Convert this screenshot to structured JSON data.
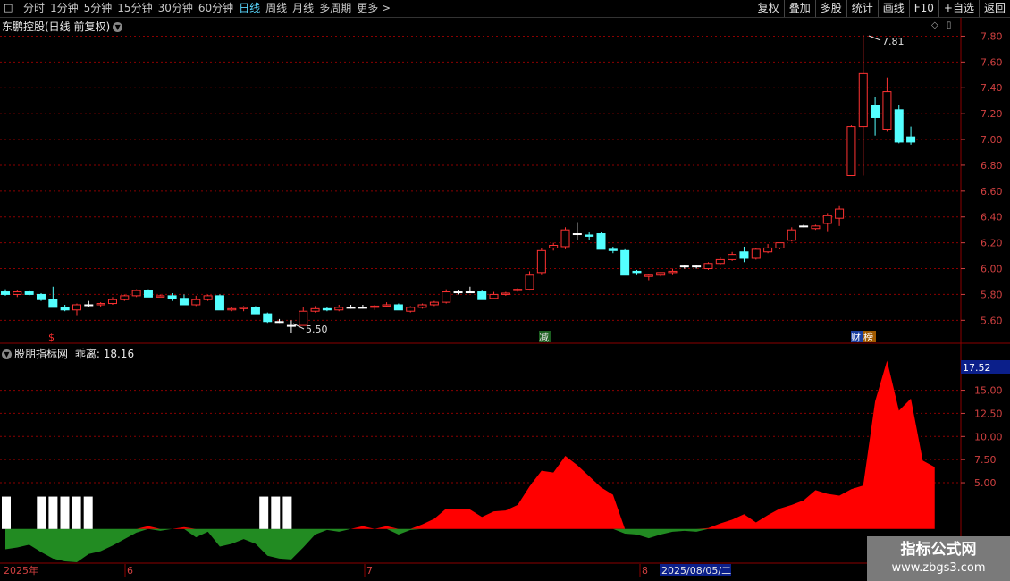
{
  "toolbar": {
    "periods": [
      "分时",
      "1分钟",
      "5分钟",
      "15分钟",
      "30分钟",
      "60分钟",
      "日线",
      "周线",
      "月线",
      "多周期",
      "更多 >"
    ],
    "active_period": "日线",
    "right_buttons": [
      "复权",
      "叠加",
      "多股",
      "统计",
      "画线",
      "F10",
      "+自选",
      "返回"
    ]
  },
  "main_header": {
    "title": "东鹏控股(日线 前复权)"
  },
  "sub_header": {
    "name": "股朋指标网",
    "label": "乖离:",
    "value": "18.16"
  },
  "main_axis": {
    "ticks": [
      "7.80",
      "7.60",
      "7.40",
      "7.20",
      "7.00",
      "6.80",
      "6.60",
      "6.40",
      "6.20",
      "6.00",
      "5.80",
      "5.60"
    ],
    "min": 5.45,
    "max": 7.9
  },
  "sub_axis": {
    "ticks": [
      "15.00",
      "12.50",
      "10.00",
      "7.50",
      "5.00"
    ],
    "current": "17.52",
    "min": -3.5,
    "max": 19.5
  },
  "annotations": {
    "high": "7.81",
    "low": "5.50"
  },
  "markers": {
    "m1": "$",
    "m2": "减",
    "m3": "财",
    "m4": "榜"
  },
  "dates": {
    "d1": "2025年",
    "d2": "6",
    "d3": "7",
    "d4": "8",
    "d5": "2025/08/05/二"
  },
  "watermark": {
    "line1": "指标公式网",
    "line2": "www.zbgs3.com"
  },
  "colors": {
    "up": "#ff3232",
    "down": "#54ffff",
    "flat": "#ffffff",
    "bias_pos": "#ff0000",
    "bias_neg": "#228b22",
    "grid": "#8b0000"
  },
  "chart_data": {
    "type": "candlestick",
    "candles": [
      [
        5.82,
        5.84,
        5.79,
        5.8
      ],
      [
        5.8,
        5.83,
        5.78,
        5.82
      ],
      [
        5.82,
        5.83,
        5.79,
        5.8
      ],
      [
        5.8,
        5.81,
        5.75,
        5.76
      ],
      [
        5.76,
        5.86,
        5.7,
        5.7
      ],
      [
        5.7,
        5.72,
        5.67,
        5.68
      ],
      [
        5.68,
        5.73,
        5.64,
        5.72
      ],
      [
        5.72,
        5.75,
        5.7,
        5.72
      ],
      [
        5.72,
        5.74,
        5.7,
        5.73
      ],
      [
        5.73,
        5.78,
        5.72,
        5.76
      ],
      [
        5.76,
        5.8,
        5.75,
        5.79
      ],
      [
        5.79,
        5.84,
        5.78,
        5.83
      ],
      [
        5.83,
        5.84,
        5.78,
        5.78
      ],
      [
        5.78,
        5.8,
        5.78,
        5.79
      ],
      [
        5.79,
        5.81,
        5.75,
        5.77
      ],
      [
        5.77,
        5.8,
        5.72,
        5.72
      ],
      [
        5.72,
        5.79,
        5.71,
        5.76
      ],
      [
        5.76,
        5.8,
        5.75,
        5.79
      ],
      [
        5.79,
        5.8,
        5.68,
        5.68
      ],
      [
        5.68,
        5.7,
        5.67,
        5.69
      ],
      [
        5.69,
        5.71,
        5.67,
        5.7
      ],
      [
        5.7,
        5.71,
        5.65,
        5.65
      ],
      [
        5.65,
        5.66,
        5.58,
        5.59
      ],
      [
        5.59,
        5.61,
        5.58,
        5.59
      ],
      [
        5.56,
        5.6,
        5.5,
        5.56
      ],
      [
        5.56,
        5.7,
        5.56,
        5.67
      ],
      [
        5.67,
        5.71,
        5.66,
        5.69
      ],
      [
        5.69,
        5.7,
        5.67,
        5.68
      ],
      [
        5.68,
        5.72,
        5.67,
        5.7
      ],
      [
        5.7,
        5.72,
        5.69,
        5.7
      ],
      [
        5.7,
        5.72,
        5.69,
        5.7
      ],
      [
        5.7,
        5.72,
        5.68,
        5.71
      ],
      [
        5.71,
        5.74,
        5.7,
        5.72
      ],
      [
        5.72,
        5.73,
        5.68,
        5.68
      ],
      [
        5.67,
        5.71,
        5.66,
        5.7
      ],
      [
        5.7,
        5.73,
        5.69,
        5.72
      ],
      [
        5.72,
        5.75,
        5.71,
        5.74
      ],
      [
        5.74,
        5.84,
        5.73,
        5.82
      ],
      [
        5.82,
        5.83,
        5.8,
        5.82
      ],
      [
        5.82,
        5.86,
        5.81,
        5.82
      ],
      [
        5.82,
        5.83,
        5.76,
        5.76
      ],
      [
        5.77,
        5.82,
        5.77,
        5.8
      ],
      [
        5.8,
        5.82,
        5.79,
        5.81
      ],
      [
        5.83,
        5.85,
        5.82,
        5.84
      ],
      [
        5.84,
        5.98,
        5.83,
        5.95
      ],
      [
        5.97,
        6.16,
        5.95,
        6.14
      ],
      [
        6.16,
        6.2,
        6.14,
        6.18
      ],
      [
        6.17,
        6.32,
        6.15,
        6.3
      ],
      [
        6.27,
        6.36,
        6.22,
        6.27
      ],
      [
        6.26,
        6.28,
        6.22,
        6.25
      ],
      [
        6.27,
        6.28,
        6.15,
        6.15
      ],
      [
        6.15,
        6.17,
        6.12,
        6.14
      ],
      [
        6.14,
        6.15,
        5.95,
        5.95
      ],
      [
        5.98,
        5.99,
        5.95,
        5.97
      ],
      [
        5.94,
        5.96,
        5.91,
        5.95
      ],
      [
        5.95,
        5.97,
        5.94,
        5.97
      ],
      [
        5.97,
        6.0,
        5.95,
        5.98
      ],
      [
        6.02,
        6.03,
        6.0,
        6.02
      ],
      [
        6.02,
        6.03,
        6.0,
        6.02
      ],
      [
        6.0,
        6.05,
        5.99,
        6.04
      ],
      [
        6.04,
        6.09,
        6.03,
        6.07
      ],
      [
        6.07,
        6.13,
        6.06,
        6.11
      ],
      [
        6.13,
        6.17,
        6.05,
        6.08
      ],
      [
        6.08,
        6.16,
        6.07,
        6.15
      ],
      [
        6.13,
        6.19,
        6.12,
        6.16
      ],
      [
        6.16,
        6.2,
        6.15,
        6.2
      ],
      [
        6.22,
        6.32,
        6.21,
        6.3
      ],
      [
        6.33,
        6.34,
        6.32,
        6.33
      ],
      [
        6.31,
        6.34,
        6.3,
        6.33
      ],
      [
        6.35,
        6.43,
        6.29,
        6.41
      ],
      [
        6.39,
        6.49,
        6.33,
        6.46
      ],
      [
        6.72,
        7.11,
        6.72,
        7.1
      ],
      [
        7.1,
        7.81,
        6.72,
        7.51
      ],
      [
        7.26,
        7.33,
        7.03,
        7.17
      ],
      [
        7.08,
        7.48,
        7.06,
        7.37
      ],
      [
        7.23,
        7.27,
        6.97,
        6.98
      ],
      [
        7.02,
        7.1,
        6.96,
        6.98
      ]
    ],
    "bias": [
      -2.2,
      -2.0,
      -1.7,
      -2.5,
      -3.2,
      -3.5,
      -3.6,
      -2.7,
      -2.4,
      -1.8,
      -1.1,
      -0.4,
      0.3,
      -0.2,
      0.0,
      0.2,
      -0.9,
      -0.3,
      -1.9,
      -1.6,
      -1.1,
      -1.6,
      -2.9,
      -3.2,
      -3.3,
      -2.0,
      -0.6,
      -0.1,
      -0.3,
      0.0,
      0.3,
      0.0,
      0.3,
      -0.6,
      -0.1,
      0.5,
      1.1,
      2.2,
      2.1,
      2.1,
      1.3,
      1.9,
      2.0,
      2.6,
      4.6,
      6.3,
      6.1,
      7.9,
      6.9,
      5.7,
      4.5,
      3.7,
      -0.5,
      -0.6,
      -1.0,
      -0.6,
      -0.3,
      -0.2,
      -0.3,
      0.1,
      0.6,
      1.0,
      1.6,
      0.7,
      1.5,
      2.2,
      2.6,
      3.1,
      4.2,
      3.8,
      3.6,
      4.3,
      4.7,
      13.8,
      18.2,
      12.8,
      14.1,
      7.4,
      6.7
    ],
    "flags": [
      1,
      0,
      0,
      1,
      1,
      1,
      1,
      1,
      0,
      0,
      0,
      0,
      0,
      0,
      0,
      0,
      0,
      0,
      0,
      0,
      0,
      0,
      1,
      1,
      1,
      0
    ]
  }
}
